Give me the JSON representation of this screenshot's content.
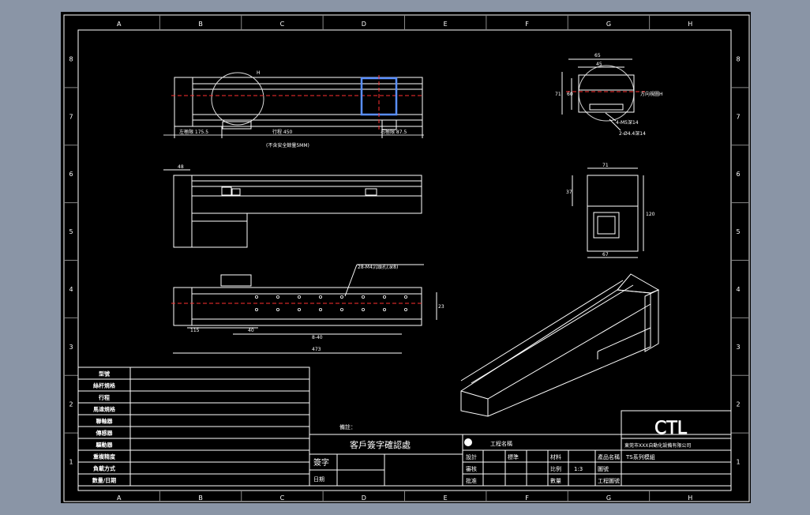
{
  "sheet": {
    "column_labels": [
      "A",
      "B",
      "C",
      "D",
      "E",
      "F",
      "G",
      "H"
    ],
    "row_labels": [
      "8",
      "7",
      "6",
      "5",
      "4",
      "3",
      "2",
      "1"
    ]
  },
  "dimensions": {
    "view1_left": "左極限 175.5",
    "view1_stroke": "行程 450",
    "view1_right": "右極限 87.5",
    "view1_note": "(不含安全餘量5MM)",
    "view1_h": "H",
    "view2_48": "48",
    "view3_hole_note": "28-M4沉頭孔(深8)",
    "view3_115": "115",
    "view3_40": "40",
    "view3_pitch": "8-40",
    "view3_total": "473",
    "view3_height": "23",
    "end_width": "65",
    "end_width2": "45",
    "end_height": "71",
    "end_height2": "60",
    "end_view_label": "方向視圖H",
    "end_hole1": "4-M5深14",
    "end_hole2": "2-Ø4.4深14",
    "side_width": "71",
    "side_h1": "37",
    "side_h2": "120",
    "side_bottom": "67"
  },
  "left_table": {
    "rows": [
      "型號",
      "絲杆規格",
      "行程",
      "馬達規格",
      "聯軸器",
      "傳感器",
      "驅動器",
      "重複精度",
      "負載方式",
      "數量/日期"
    ]
  },
  "title_block": {
    "notes_label": "備註：",
    "customer_confirm": "客戶簽字確認處",
    "sign_label": "簽字",
    "date_label": "日期",
    "design": "設計",
    "review": "審核",
    "approve": "批准",
    "standard": "標準",
    "drawing_no_label": "圖號",
    "material": "材料",
    "scale_label": "比例",
    "scale_value": "1:3",
    "qty_label": "數量",
    "part_name_label": "產品名稱",
    "customer_name_label": "工程名稱",
    "brand": "CTL",
    "company": "東莞市XXX自動化設備有限公司",
    "model": "TS系列模組",
    "sheet_note": "工程圖號"
  }
}
